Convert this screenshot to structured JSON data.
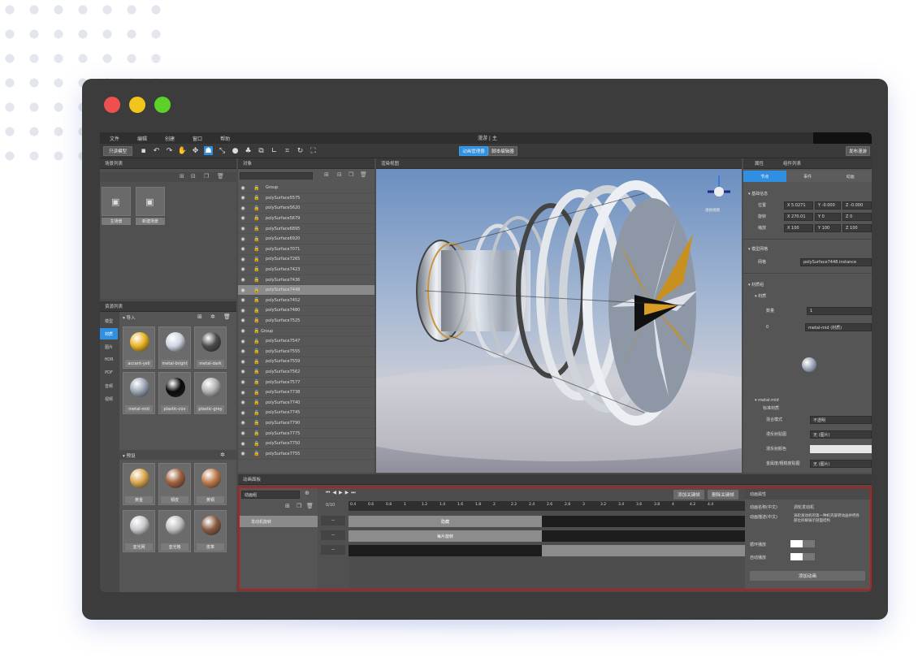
{
  "window": {
    "title": "漫游 | 主"
  },
  "menu": [
    "文件",
    "编辑",
    "创建",
    "窗口",
    "帮助"
  ],
  "toolbar": {
    "left_button": "只读模型",
    "mode_a": "动画管理器",
    "mode_b": "脚本编辑器",
    "right_button": "发布漫游"
  },
  "scene_list": {
    "title": "场景列表",
    "items": [
      "主场景",
      "新建场景"
    ]
  },
  "resource_list": {
    "title": "资源列表",
    "tabs": [
      "模型",
      "材质",
      "图片",
      "HDR",
      "PDF",
      "音频",
      "视频"
    ],
    "import_title": "导入",
    "materials": [
      {
        "name": "accent-yell",
        "color": "#e8b21f"
      },
      {
        "name": "metal-bright",
        "color": "#cfd6e2"
      },
      {
        "name": "metal-dark",
        "color": "#4a4a4a"
      },
      {
        "name": "metal-mid",
        "color": "#9aa4b4"
      },
      {
        "name": "plastic-cov",
        "color": "#0a0a0a"
      },
      {
        "name": "plastic-grey",
        "color": "#b0b0b0"
      }
    ],
    "preset_title": "预设",
    "presets": [
      {
        "name": "黄金",
        "color": "#d9a64a"
      },
      {
        "name": "铜皮",
        "color": "#a0603c"
      },
      {
        "name": "黄铜",
        "color": "#c07a4a"
      },
      {
        "name": "亚光网",
        "color": "#c8c8cc"
      },
      {
        "name": "亚光格",
        "color": "#bfbfbf"
      },
      {
        "name": "皮革",
        "color": "#8a5a40"
      }
    ]
  },
  "outliner": {
    "title": "对象",
    "group": "Group",
    "items": [
      "polySurface5575",
      "polySurface5620",
      "polySurface5679",
      "polySurface6895",
      "polySurface6920",
      "polySurface7071",
      "polySurface7265",
      "polySurface7423",
      "polySurface7436",
      "polySurface7448",
      "polySurface7452",
      "polySurface7480",
      "polySurface7525",
      "Group",
      "polySurface7547",
      "polySurface7555",
      "polySurface7559",
      "polySurface7562",
      "polySurface7577",
      "polySurface7738",
      "polySurface7740",
      "polySurface7745",
      "polySurface7790",
      "polySurface7775",
      "polySurface7750",
      "polySurface7755"
    ],
    "selected_index": 9
  },
  "viewport": {
    "title": "渲染视图",
    "gizmo_label": "透视视图"
  },
  "properties": {
    "tabs": [
      "属性",
      "组件列表"
    ],
    "subtabs": [
      "节点",
      "事件",
      "动画"
    ],
    "transform_title": "基础信息",
    "pos_label": "位置",
    "rot_label": "旋转",
    "scale_label": "缩放",
    "pos": [
      "X 5.0271",
      "Y -0.000",
      "Z -0.000"
    ],
    "rot": [
      "X 270.01",
      "Y 0",
      "Z 0"
    ],
    "scale": [
      "X 100",
      "Y 100",
      "Z 100"
    ],
    "mesh_title": "模型网格",
    "mesh_label": "网格",
    "mesh_value": "polySurface7448.instance",
    "material_title": "材质组",
    "mat_sub": "材质",
    "count_label": "数量",
    "count_value": "1",
    "slot_label": "0",
    "slot_value": "metal-mid (材质)",
    "mat_name": "metal-mid",
    "mat_params": "标准材质",
    "blend_label": "混合模式",
    "blend_value": "不透明",
    "tex_label": "漫反射贴图",
    "tex_value": "无 (图片)",
    "color_label": "漫反射颜色",
    "spec_label": "金属度/粗糙度贴图",
    "spec_value": "无 (图片)"
  },
  "animation": {
    "title": "动画面板",
    "clip": "动画组",
    "left_track": "发动机旋转",
    "frame_label": "0/10",
    "ruler": [
      "0.4",
      "0.6",
      "0.8",
      "1",
      "1.2",
      "1.4",
      "1.6",
      "1.8",
      "2",
      "2.2",
      "2.4",
      "2.6",
      "2.8",
      "3",
      "3.2",
      "3.4",
      "3.6",
      "3.8",
      "4",
      "4.2",
      "4.4"
    ],
    "clip_a": "隐藏",
    "clip_b": "每片旋转",
    "btn_add": "添加关键帧",
    "btn_del": "删除关键帧",
    "props_title": "动画属性",
    "name_label": "动画名称(中文)",
    "name_value": "涡轮发动机",
    "desc_label": "动画描述(中文)",
    "desc_value": "涡轮发动机的第一种机壳旋转动画并把各部位拆解展示剖面结构",
    "loop_label": "循环播放",
    "auto_label": "自动播放",
    "apply_button": "添加动画"
  },
  "colors": {
    "accent": "#2f8fe0",
    "panel": "#555555",
    "dark": "#3a3a3a",
    "anim_border": "#b42020"
  }
}
